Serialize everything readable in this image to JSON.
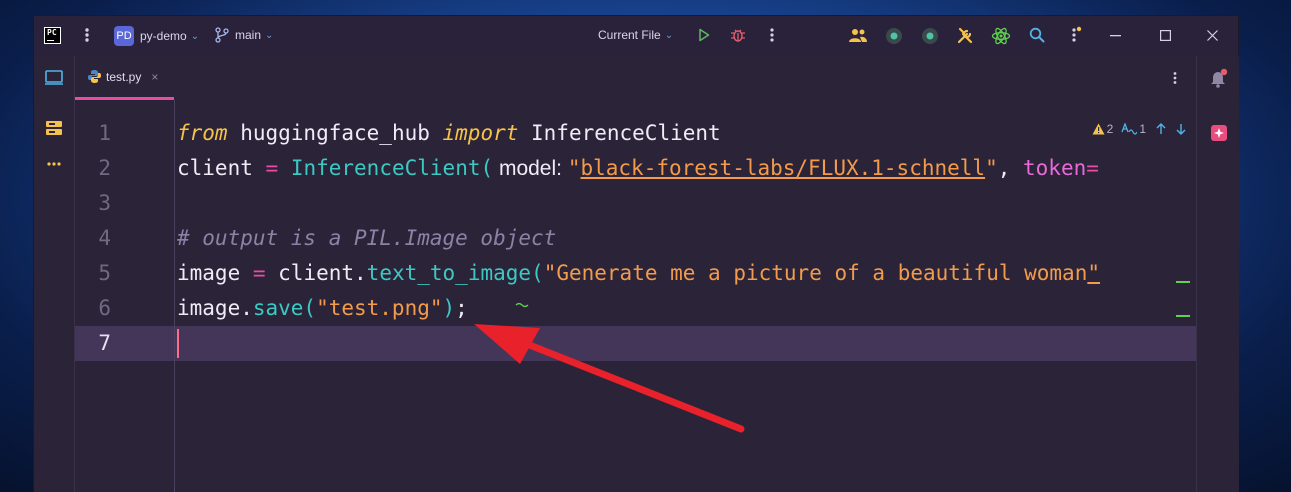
{
  "titlebar": {
    "logo_text": "PC",
    "project_badge": "PD",
    "project_name": "py-demo",
    "branch_name": "main",
    "run_config": "Current File"
  },
  "tabs": [
    {
      "label": "test.py",
      "close": "×"
    }
  ],
  "inspections": {
    "warnings": "2",
    "typos": "1"
  },
  "editor": {
    "line_numbers": [
      "1",
      "2",
      "3",
      "4",
      "5",
      "6",
      "7"
    ],
    "lines": [
      [
        {
          "t": "from",
          "c": "kw"
        },
        {
          "t": " huggingface_hub ",
          "c": ""
        },
        {
          "t": "import",
          "c": "kw"
        },
        {
          "t": " InferenceClient",
          "c": ""
        }
      ],
      [
        {
          "t": "client ",
          "c": ""
        },
        {
          "t": "=",
          "c": "op"
        },
        {
          "t": " ",
          "c": ""
        },
        {
          "t": "InferenceClient(",
          "c": "fn"
        },
        {
          "t": " model: ",
          "c": "param"
        },
        {
          "t": "\"",
          "c": "str"
        },
        {
          "t": "black-forest-labs/FLUX.1-schnell",
          "c": "str-u"
        },
        {
          "t": "\"",
          "c": "str"
        },
        {
          "t": ", ",
          "c": ""
        },
        {
          "t": "token",
          "c": "kwarg"
        },
        {
          "t": "=",
          "c": "op"
        }
      ],
      [],
      [
        {
          "t": "# output is a PIL.Image object",
          "c": "cm"
        }
      ],
      [
        {
          "t": "image ",
          "c": ""
        },
        {
          "t": "=",
          "c": "op"
        },
        {
          "t": " client.",
          "c": ""
        },
        {
          "t": "text_to_image(",
          "c": "fn"
        },
        {
          "t": "\"Generate me a picture of a beautiful woman",
          "c": "str"
        },
        {
          "t": "\"",
          "c": "str-u"
        }
      ],
      [
        {
          "t": "image.",
          "c": ""
        },
        {
          "t": "save(",
          "c": "fn"
        },
        {
          "t": "\"test.png\"",
          "c": "str"
        },
        {
          "t": ")",
          "c": "fn"
        },
        {
          "t": ";",
          "c": ""
        }
      ],
      []
    ]
  },
  "colors": {
    "accent_tab": "#e94ca2",
    "arrow": "#e8212b",
    "current_line": "#433659"
  }
}
